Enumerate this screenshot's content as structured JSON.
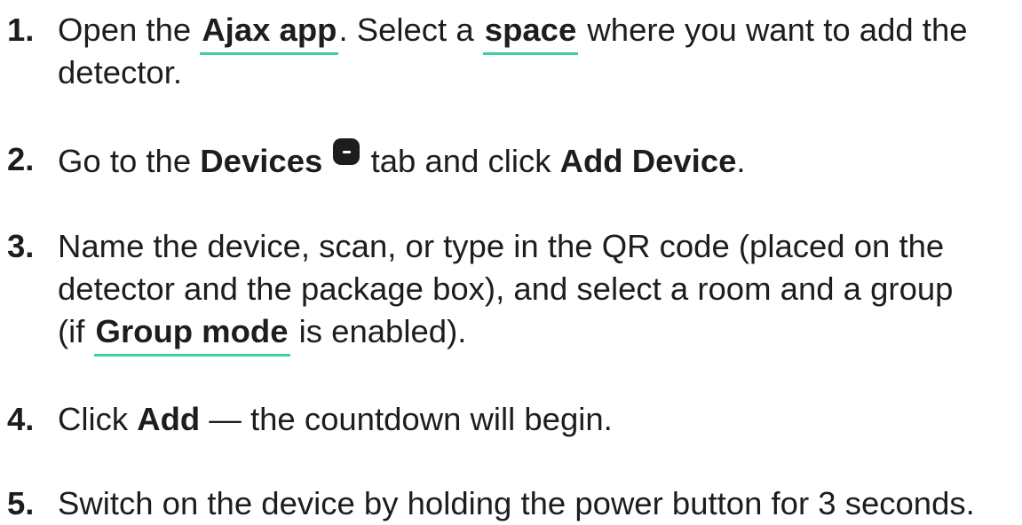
{
  "steps": [
    {
      "number": "1.",
      "line1_a": "Open the ",
      "link1": "Ajax app",
      "line1_b": ". Select a ",
      "link2": "space",
      "line1_c": " where you want to add the",
      "line2": "detector."
    },
    {
      "number": "2.",
      "text_a": "Go to the ",
      "bold1": "Devices",
      "icon": "devices-tab-icon",
      "text_b": " tab and click ",
      "bold2": "Add Device",
      "text_c": "."
    },
    {
      "number": "3.",
      "line1": "Name the device, scan, or type in the QR code (placed on the",
      "line2": "detector and the package box), and select a room and a group",
      "line3_a": "(if ",
      "link": "Group mode",
      "line3_b": " is enabled)."
    },
    {
      "number": "4.",
      "text_a": "Click ",
      "bold": "Add",
      "text_b": " — the countdown will begin."
    },
    {
      "number": "5.",
      "text": "Switch on the device by holding the power button for 3 seconds."
    }
  ],
  "colors": {
    "text": "#1d1d1f",
    "link_underline": "#3ecf9a",
    "background": "#ffffff"
  }
}
